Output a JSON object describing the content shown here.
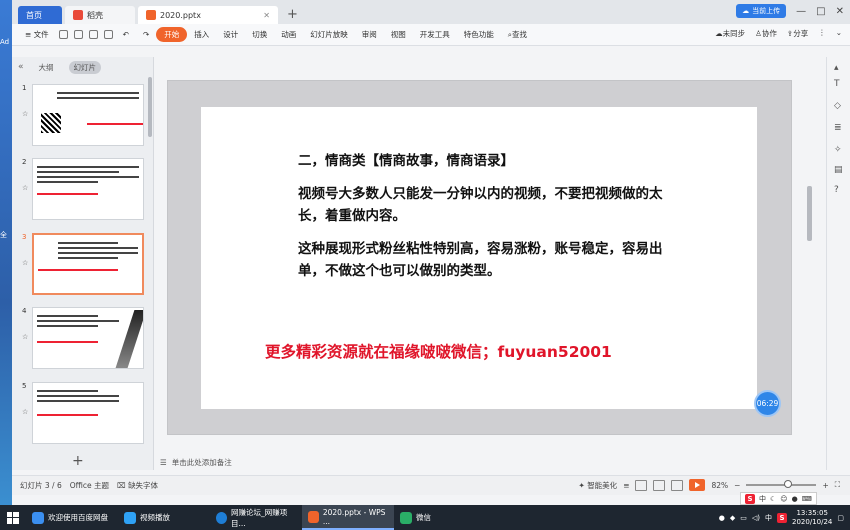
{
  "desktop": {
    "labels": [
      "Ad",
      "全"
    ]
  },
  "tabs": {
    "home": "首页",
    "doke": "稻壳",
    "doc": "2020.pptx",
    "upload": "当前上传"
  },
  "menu": {
    "file": "文件",
    "items": [
      "开始",
      "插入",
      "设计",
      "切换",
      "动画",
      "幻灯片放映",
      "审阅",
      "视图",
      "开发工具",
      "特色功能"
    ],
    "search": "查找",
    "unsync": "未同步",
    "collab": "协作",
    "share": "分享"
  },
  "pane": {
    "outline": "大纲",
    "slides": "幻灯片",
    "numbers": [
      "1",
      "2",
      "3",
      "4",
      "5"
    ],
    "star": "☆"
  },
  "slide": {
    "heading": "二，情商类【情商故事，情商语录】",
    "p1": "视频号大多数人只能发一分钟以内的视频，不要把视频做的太长，着重做内容。",
    "p2": "这种展现形式粉丝粘性特别高，容易涨粉，账号稳定，容易出单，不做这个也可以做别的类型。",
    "promo": "更多精彩资源就在福缘啵啵微信；fuyuan52001",
    "timer": "06:29"
  },
  "notes": {
    "placeholder": "单击此处添加备注"
  },
  "status": {
    "slide_index": "幻灯片 3 / 6",
    "theme": "Office 主题",
    "missing_font": "缺失字体",
    "smart": "智能美化",
    "zoom": "82%"
  },
  "taskbar": {
    "items": [
      "欢迎使用百度网盘",
      "视频播放",
      "网赚论坛_网赚项目...",
      "2020.pptx - WPS ...",
      "微信"
    ],
    "ime": "中",
    "time": "13:35:05",
    "date": "2020/10/24"
  }
}
